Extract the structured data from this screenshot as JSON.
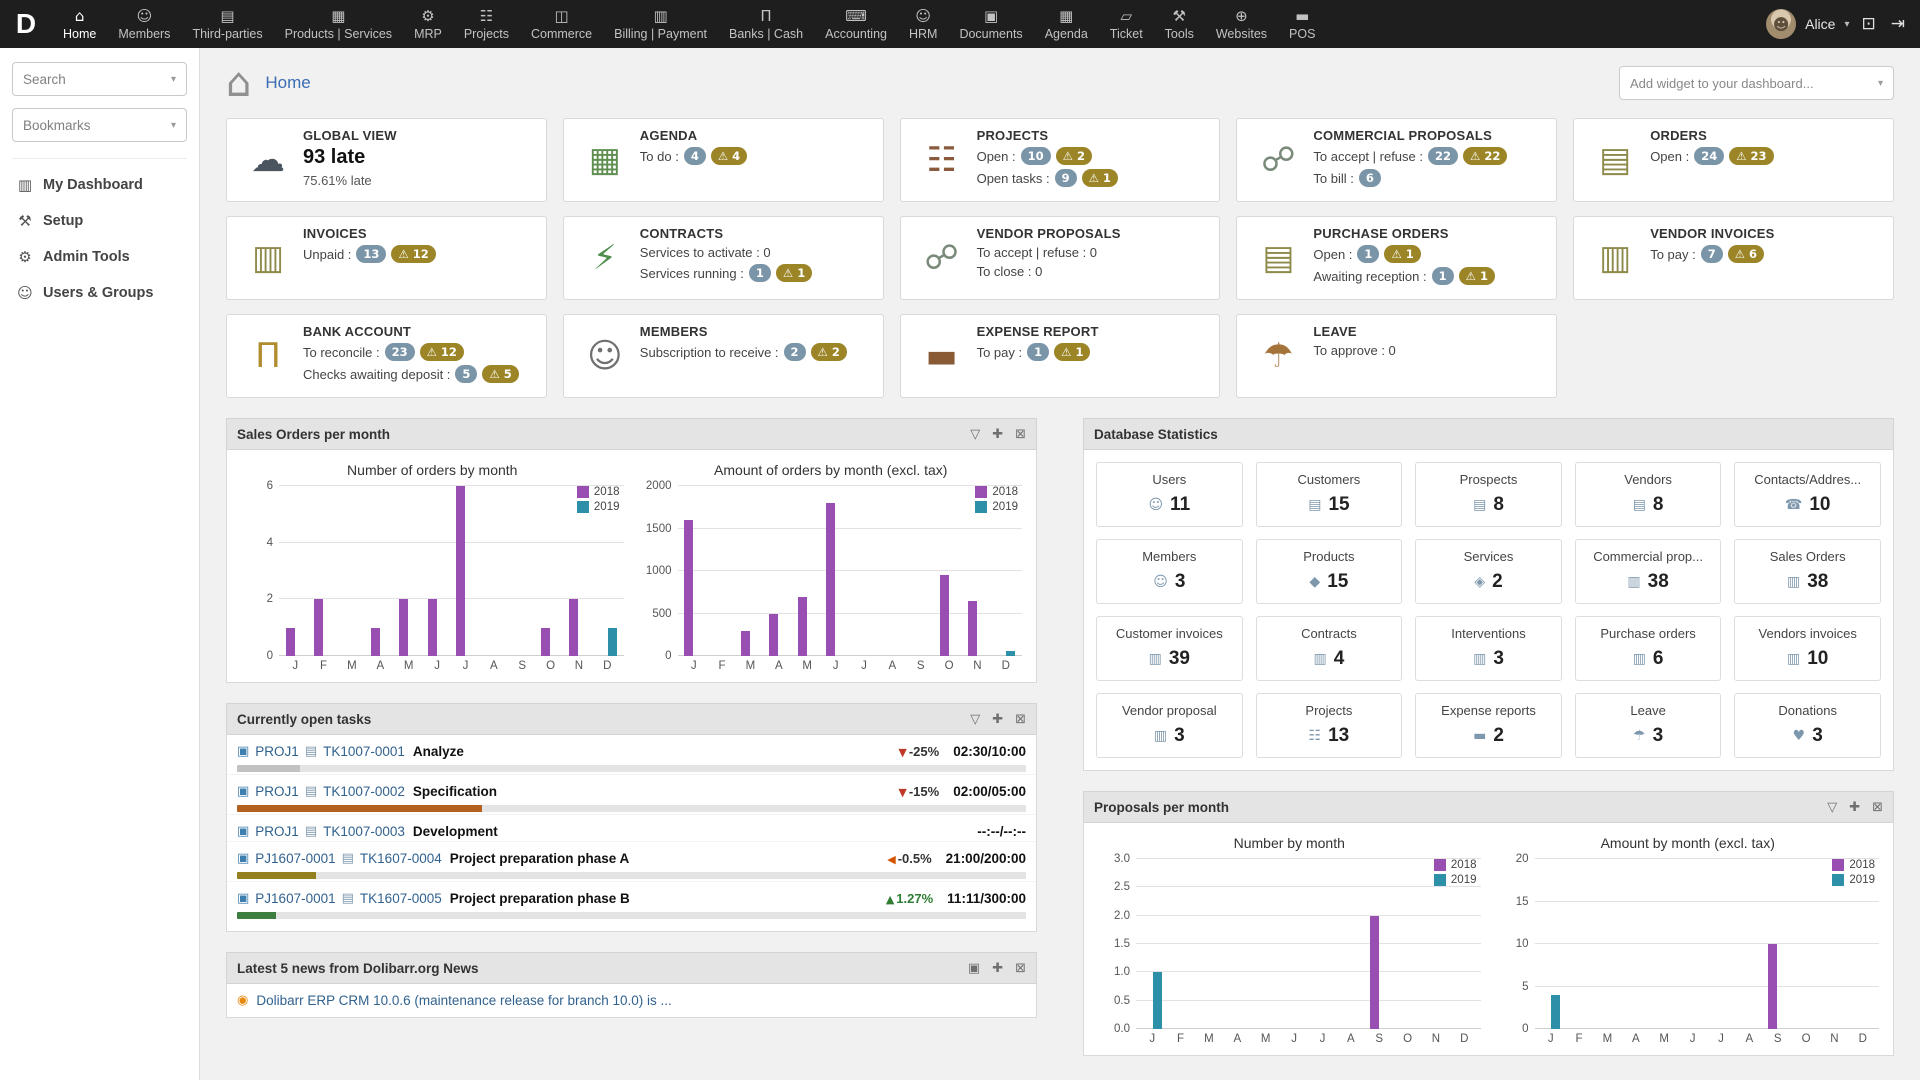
{
  "colors": {
    "navbar_bg": "#1e1e1e",
    "accent_link": "#31628f",
    "title_blue": "#3a6db4",
    "badge_info": "#7b95a8",
    "badge_warning": "#9c8527",
    "chart_2018": "#994fb2",
    "chart_2019": "#2d8fa8"
  },
  "navbar": {
    "logo": "D",
    "items": [
      {
        "label": "Home",
        "icon": "⌂",
        "active": true
      },
      {
        "label": "Members",
        "icon": "☺",
        "active": false
      },
      {
        "label": "Third-parties",
        "icon": "▤",
        "active": false
      },
      {
        "label": "Products | Services",
        "icon": "▦",
        "active": false
      },
      {
        "label": "MRP",
        "icon": "⚙",
        "active": false
      },
      {
        "label": "Projects",
        "icon": "☷",
        "active": false
      },
      {
        "label": "Commerce",
        "icon": "◫",
        "active": false
      },
      {
        "label": "Billing | Payment",
        "icon": "▥",
        "active": false
      },
      {
        "label": "Banks | Cash",
        "icon": "Π",
        "active": false
      },
      {
        "label": "Accounting",
        "icon": "⌨",
        "active": false
      },
      {
        "label": "HRM",
        "icon": "☺",
        "active": false
      },
      {
        "label": "Documents",
        "icon": "▣",
        "active": false
      },
      {
        "label": "Agenda",
        "icon": "▦",
        "active": false
      },
      {
        "label": "Ticket",
        "icon": "▱",
        "active": false
      },
      {
        "label": "Tools",
        "icon": "⚒",
        "active": false
      },
      {
        "label": "Websites",
        "icon": "⊕",
        "active": false
      },
      {
        "label": "POS",
        "icon": "▬",
        "active": false
      }
    ],
    "user": {
      "name": "Alice"
    }
  },
  "sidebar": {
    "search_label": "Search",
    "bookmarks_label": "Bookmarks",
    "items": [
      {
        "label": "My Dashboard",
        "icon": "▥"
      },
      {
        "label": "Setup",
        "icon": "⚒"
      },
      {
        "label": "Admin Tools",
        "icon": "⚙"
      },
      {
        "label": "Users & Groups",
        "icon": "☺"
      }
    ]
  },
  "header": {
    "title": "Home",
    "add_widget_placeholder": "Add widget to your dashboard..."
  },
  "widgets": [
    {
      "id": "global-view",
      "icon": "☁",
      "icon_color": "#4a5560",
      "title": "GLOBAL VIEW",
      "lines": [
        {
          "big": "93 late"
        },
        {
          "text": "75.61% late"
        }
      ]
    },
    {
      "id": "agenda",
      "icon": "▦",
      "icon_color": "#5e8f50",
      "title": "AGENDA",
      "lines": [
        {
          "label": "To do :",
          "badges": [
            {
              "t": "n",
              "v": "4"
            },
            {
              "t": "w",
              "v": "4"
            }
          ]
        }
      ]
    },
    {
      "id": "projects",
      "icon": "☷",
      "icon_color": "#8a5a3c",
      "title": "PROJECTS",
      "lines": [
        {
          "label": "Open :",
          "badges": [
            {
              "t": "n",
              "v": "10"
            },
            {
              "t": "w",
              "v": "2"
            }
          ]
        },
        {
          "label": "Open tasks :",
          "badges": [
            {
              "t": "n",
              "v": "9"
            },
            {
              "t": "w",
              "v": "1"
            }
          ]
        }
      ]
    },
    {
      "id": "commercial-proposals",
      "icon": "☍",
      "icon_color": "#7a8a7a",
      "title": "COMMERCIAL PROPOSALS",
      "lines": [
        {
          "label": "To accept | refuse :",
          "badges": [
            {
              "t": "n",
              "v": "22"
            },
            {
              "t": "w",
              "v": "22"
            }
          ]
        },
        {
          "label": "To bill :",
          "badges": [
            {
              "t": "n",
              "v": "6"
            }
          ]
        }
      ]
    },
    {
      "id": "orders",
      "icon": "▤",
      "icon_color": "#8d8a4a",
      "title": "ORDERS",
      "lines": [
        {
          "label": "Open :",
          "badges": [
            {
              "t": "n",
              "v": "24"
            },
            {
              "t": "w",
              "v": "23"
            }
          ]
        }
      ]
    },
    {
      "id": "invoices",
      "icon": "▥",
      "icon_color": "#8d8a4a",
      "title": "INVOICES",
      "lines": [
        {
          "label": "Unpaid :",
          "badges": [
            {
              "t": "n",
              "v": "13"
            },
            {
              "t": "w",
              "v": "12"
            }
          ]
        }
      ]
    },
    {
      "id": "contracts",
      "icon": "⚡",
      "icon_color": "#4f8f4e",
      "title": "CONTRACTS",
      "lines": [
        {
          "label": "Services to activate : 0",
          "badges": []
        },
        {
          "label": "Services running :",
          "badges": [
            {
              "t": "n",
              "v": "1"
            },
            {
              "t": "w",
              "v": "1"
            }
          ]
        }
      ]
    },
    {
      "id": "vendor-proposals",
      "icon": "☍",
      "icon_color": "#7a8a7a",
      "title": "VENDOR PROPOSALS",
      "lines": [
        {
          "label": "To accept | refuse : 0",
          "badges": []
        },
        {
          "label": "To close : 0",
          "badges": []
        }
      ]
    },
    {
      "id": "purchase-orders",
      "icon": "▤",
      "icon_color": "#8d8a4a",
      "title": "PURCHASE ORDERS",
      "lines": [
        {
          "label": "Open :",
          "badges": [
            {
              "t": "n",
              "v": "1"
            },
            {
              "t": "w",
              "v": "1"
            }
          ]
        },
        {
          "label": "Awaiting reception :",
          "badges": [
            {
              "t": "n",
              "v": "1"
            },
            {
              "t": "w",
              "v": "1"
            }
          ]
        }
      ]
    },
    {
      "id": "vendor-invoices",
      "icon": "▥",
      "icon_color": "#8d8a4a",
      "title": "VENDOR INVOICES",
      "lines": [
        {
          "label": "To pay :",
          "badges": [
            {
              "t": "n",
              "v": "7"
            },
            {
              "t": "w",
              "v": "6"
            }
          ]
        }
      ]
    },
    {
      "id": "bank-account",
      "icon": "Π",
      "icon_color": "#b08c2e",
      "title": "BANK ACCOUNT",
      "lines": [
        {
          "label": "To reconcile :",
          "badges": [
            {
              "t": "n",
              "v": "23"
            },
            {
              "t": "w",
              "v": "12"
            }
          ]
        },
        {
          "label": "Checks awaiting deposit :",
          "badges": [
            {
              "t": "n",
              "v": "5"
            },
            {
              "t": "w",
              "v": "5"
            }
          ]
        }
      ]
    },
    {
      "id": "members",
      "icon": "☺",
      "icon_color": "#707070",
      "title": "MEMBERS",
      "lines": [
        {
          "label": "Subscription to receive :",
          "badges": [
            {
              "t": "n",
              "v": "2"
            },
            {
              "t": "w",
              "v": "2"
            }
          ]
        }
      ]
    },
    {
      "id": "expense-report",
      "icon": "▬",
      "icon_color": "#8a5a35",
      "title": "EXPENSE REPORT",
      "lines": [
        {
          "label": "To pay :",
          "badges": [
            {
              "t": "n",
              "v": "1"
            },
            {
              "t": "w",
              "v": "1"
            }
          ]
        }
      ]
    },
    {
      "id": "leave",
      "icon": "☂",
      "icon_color": "#a5743a",
      "title": "LEAVE",
      "lines": [
        {
          "label": "To approve : 0",
          "badges": []
        }
      ]
    }
  ],
  "sales_orders": {
    "title": "Sales Orders per month",
    "icons": [
      "filter",
      "move",
      "close"
    ]
  },
  "open_tasks": {
    "title": "Currently open tasks",
    "icons": [
      "filter",
      "move",
      "close"
    ],
    "rows": [
      {
        "project": "PROJ1",
        "task": "TK1007-0001",
        "name": "Analyze",
        "trend": "down",
        "pct": "-25%",
        "time": "02:30/10:00",
        "progress": 8,
        "bar": "#c2c2c2"
      },
      {
        "project": "PROJ1",
        "task": "TK1007-0002",
        "name": "Specification",
        "trend": "down",
        "pct": "-15%",
        "time": "02:00/05:00",
        "progress": 31,
        "bar": "#b4611f"
      },
      {
        "project": "PROJ1",
        "task": "TK1007-0003",
        "name": "Development",
        "trend": "",
        "pct": "",
        "time": "--:--/--:--",
        "progress": null,
        "bar": ""
      },
      {
        "project": "PJ1607-0001",
        "task": "TK1607-0004",
        "name": "Project preparation phase A",
        "trend": "left",
        "pct": "-0.5%",
        "time": "21:00/200:00",
        "progress": 10,
        "bar": "#94801f"
      },
      {
        "project": "PJ1607-0001",
        "task": "TK1607-0005",
        "name": "Project preparation phase B",
        "trend": "up",
        "pct": "1.27%",
        "time": "11:11/300:00",
        "progress": 5,
        "bar": "#3e7e41"
      }
    ]
  },
  "news": {
    "title": "Latest 5 news from Dolibarr.org News",
    "icons": [
      "widget",
      "move",
      "close"
    ],
    "items": [
      {
        "text": "Dolibarr ERP CRM 10.0.6 (maintenance release for branch 10.0) is ..."
      }
    ]
  },
  "db_stats": {
    "title": "Database Statistics",
    "cards": [
      {
        "label": "Users",
        "value": "11",
        "icon": "☺"
      },
      {
        "label": "Customers",
        "value": "15",
        "icon": "▤"
      },
      {
        "label": "Prospects",
        "value": "8",
        "icon": "▤"
      },
      {
        "label": "Vendors",
        "value": "8",
        "icon": "▤"
      },
      {
        "label": "Contacts/Addres...",
        "value": "10",
        "icon": "☎"
      },
      {
        "label": "Members",
        "value": "3",
        "icon": "☺"
      },
      {
        "label": "Products",
        "value": "15",
        "icon": "◆"
      },
      {
        "label": "Services",
        "value": "2",
        "icon": "◈"
      },
      {
        "label": "Commercial prop...",
        "value": "38",
        "icon": "▥"
      },
      {
        "label": "Sales Orders",
        "value": "38",
        "icon": "▥"
      },
      {
        "label": "Customer invoices",
        "value": "39",
        "icon": "▥"
      },
      {
        "label": "Contracts",
        "value": "4",
        "icon": "▥"
      },
      {
        "label": "Interventions",
        "value": "3",
        "icon": "▥"
      },
      {
        "label": "Purchase orders",
        "value": "6",
        "icon": "▥"
      },
      {
        "label": "Vendors invoices",
        "value": "10",
        "icon": "▥"
      },
      {
        "label": "Vendor proposal",
        "value": "3",
        "icon": "▥"
      },
      {
        "label": "Projects",
        "value": "13",
        "icon": "☷"
      },
      {
        "label": "Expense reports",
        "value": "2",
        "icon": "▬"
      },
      {
        "label": "Leave",
        "value": "3",
        "icon": "☂"
      },
      {
        "label": "Donations",
        "value": "3",
        "icon": "♥"
      }
    ]
  },
  "proposals": {
    "title": "Proposals per month",
    "icons": [
      "filter",
      "move",
      "close"
    ]
  },
  "chart_data": [
    {
      "type": "bar",
      "title": "Number of orders by month",
      "categories": [
        "J",
        "F",
        "M",
        "A",
        "M",
        "J",
        "J",
        "A",
        "S",
        "O",
        "N",
        "D"
      ],
      "series": [
        {
          "name": "2018",
          "values": [
            1,
            2,
            0,
            1,
            2,
            2,
            6,
            0,
            0,
            1,
            2,
            0
          ]
        },
        {
          "name": "2019",
          "values": [
            0,
            0,
            0,
            0,
            0,
            0,
            0,
            0,
            0,
            0,
            0,
            1
          ]
        }
      ],
      "ylim": [
        0,
        6
      ],
      "yticks": [
        0,
        2,
        4,
        6
      ],
      "ytick_labels": [
        "0",
        "2",
        "4",
        "6"
      ],
      "legend_position": "top-right"
    },
    {
      "type": "bar",
      "title": "Amount of orders by month (excl. tax)",
      "categories": [
        "J",
        "F",
        "M",
        "A",
        "M",
        "J",
        "J",
        "A",
        "S",
        "O",
        "N",
        "D"
      ],
      "series": [
        {
          "name": "2018",
          "values": [
            1600,
            0,
            300,
            500,
            700,
            1800,
            0,
            0,
            0,
            950,
            650,
            0
          ]
        },
        {
          "name": "2019",
          "values": [
            0,
            0,
            0,
            0,
            0,
            0,
            0,
            0,
            0,
            0,
            0,
            60
          ]
        }
      ],
      "ylim": [
        0,
        2000
      ],
      "yticks": [
        0,
        500,
        1000,
        1500,
        2000
      ],
      "ytick_labels": [
        "0",
        "500",
        "1000",
        "1500",
        "2000"
      ],
      "legend_position": "top-right"
    },
    {
      "type": "bar",
      "title": "Number by month",
      "categories": [
        "J",
        "F",
        "M",
        "A",
        "M",
        "J",
        "J",
        "A",
        "S",
        "O",
        "N",
        "D"
      ],
      "series": [
        {
          "name": "2018",
          "values": [
            0,
            0,
            0,
            0,
            0,
            0,
            0,
            0,
            2,
            0,
            0,
            0
          ]
        },
        {
          "name": "2019",
          "values": [
            1,
            0,
            0,
            0,
            0,
            0,
            0,
            0,
            0,
            0,
            0,
            0
          ]
        }
      ],
      "ylim": [
        0,
        3
      ],
      "yticks": [
        0,
        0.5,
        1,
        1.5,
        2,
        2.5,
        3
      ],
      "ytick_labels": [
        "0.0",
        "0.5",
        "1.0",
        "1.5",
        "2.0",
        "2.5",
        "3.0"
      ],
      "legend_position": "top-right"
    },
    {
      "type": "bar",
      "title": "Amount by month (excl. tax)",
      "categories": [
        "J",
        "F",
        "M",
        "A",
        "M",
        "J",
        "J",
        "A",
        "S",
        "O",
        "N",
        "D"
      ],
      "series": [
        {
          "name": "2018",
          "values": [
            0,
            0,
            0,
            0,
            0,
            0,
            0,
            0,
            10,
            0,
            0,
            0
          ]
        },
        {
          "name": "2019",
          "values": [
            4,
            0,
            0,
            0,
            0,
            0,
            0,
            0,
            0,
            0,
            0,
            0
          ]
        }
      ],
      "ylim": [
        0,
        20
      ],
      "yticks": [
        0,
        5,
        10,
        15,
        20
      ],
      "ytick_labels": [
        "0",
        "5",
        "10",
        "15",
        "20"
      ],
      "legend_position": "top-right"
    }
  ]
}
